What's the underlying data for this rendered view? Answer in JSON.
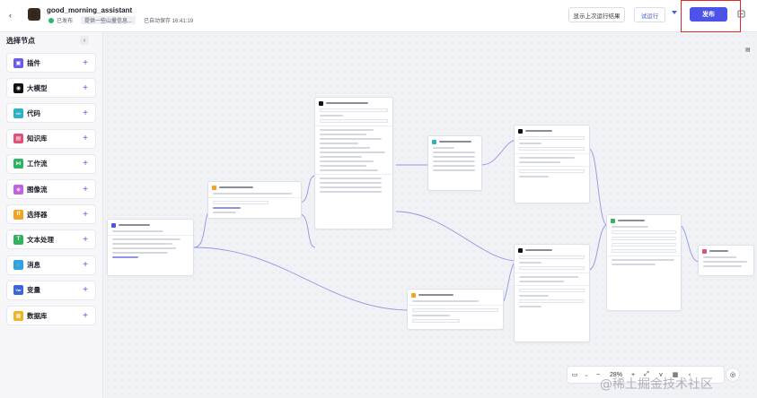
{
  "header": {
    "back_icon": "chevron-left-icon",
    "app_name": "good_morning_assistant",
    "published_status": "已发布",
    "description": "提供一些山量信息...",
    "autosave": "已自动保存 16:41:19",
    "last_run_label": "显示上次运行结果",
    "test_run_label": "试运行",
    "publish_label": "发布",
    "accent_color": "#4d53e8",
    "highlight_color": "#e52525"
  },
  "panel": {
    "title": "选择节点",
    "collapse_label": "‹",
    "items": [
      {
        "label": "插件",
        "icon": "plugin-icon",
        "color": "#6b5cf0",
        "glyph": "▣"
      },
      {
        "label": "大模型",
        "icon": "llm-icon",
        "color": "#111111",
        "glyph": "◉"
      },
      {
        "label": "代码",
        "icon": "code-icon",
        "color": "#2bb3c0",
        "glyph": "</>"
      },
      {
        "label": "知识库",
        "icon": "knowledge-icon",
        "color": "#e0527a",
        "glyph": "▤"
      },
      {
        "label": "工作流",
        "icon": "workflow-icon",
        "color": "#2fb465",
        "glyph": "⋈"
      },
      {
        "label": "图像流",
        "icon": "image-flow-icon",
        "color": "#c362e0",
        "glyph": "◈"
      },
      {
        "label": "选择器",
        "icon": "selector-icon",
        "color": "#f1a321",
        "glyph": "If"
      },
      {
        "label": "文本处理",
        "icon": "text-icon",
        "color": "#32b35d",
        "glyph": "T"
      },
      {
        "label": "消息",
        "icon": "message-icon",
        "color": "#2da3e0",
        "glyph": "◌"
      },
      {
        "label": "变量",
        "icon": "variable-icon",
        "color": "#3a66d9",
        "glyph": "Var"
      },
      {
        "label": "数据库",
        "icon": "database-icon",
        "color": "#f1b321",
        "glyph": "▦"
      }
    ]
  },
  "toolbar": {
    "minimap_icon": "minimap-icon",
    "zoom_out": "−",
    "zoom_level": "28%",
    "zoom_in": "+",
    "fit_icon": "fit-view-icon",
    "layout_icon": "layout-icon",
    "arrange_icon": "arrange-icon",
    "undo_icon": "undo-icon",
    "fit_button_icon": "focus-icon"
  },
  "watermark": "@稀土掘金技术社区"
}
